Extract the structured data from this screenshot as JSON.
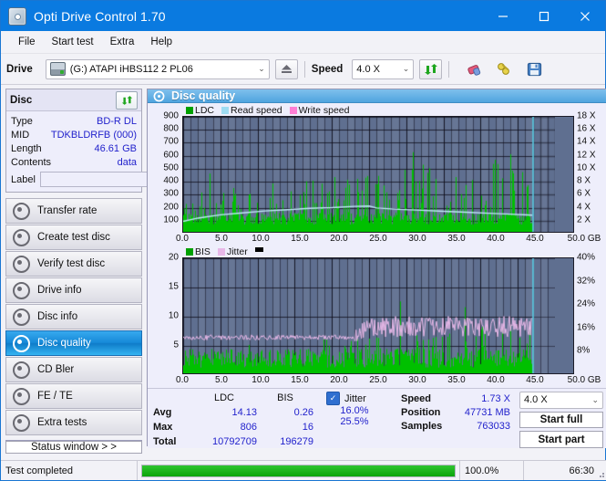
{
  "window": {
    "title": "Opti Drive Control 1.70",
    "minimize": "–",
    "maximize": "□",
    "close": "✕"
  },
  "menu": {
    "items": [
      "File",
      "Start test",
      "Extra",
      "Help"
    ]
  },
  "toolbar": {
    "drive_label": "Drive",
    "drive_value": "(G:)  ATAPI iHBS112  2 PL06",
    "eject_title": "Eject",
    "speed_label": "Speed",
    "speed_value": "4.0 X",
    "chevron": "⌄"
  },
  "disc": {
    "title": "Disc",
    "rows": [
      {
        "key": "Type",
        "value": "BD-R DL"
      },
      {
        "key": "MID",
        "value": "TDKBLDRFB (000)"
      },
      {
        "key": "Length",
        "value": "46.61 GB"
      },
      {
        "key": "Contents",
        "value": "data"
      }
    ],
    "label_key": "Label",
    "label_value": "",
    "label_placeholder": ""
  },
  "nav": {
    "items": [
      {
        "label": "Transfer rate",
        "active": false
      },
      {
        "label": "Create test disc",
        "active": false
      },
      {
        "label": "Verify test disc",
        "active": false
      },
      {
        "label": "Drive info",
        "active": false
      },
      {
        "label": "Disc info",
        "active": false
      },
      {
        "label": "Disc quality",
        "active": true
      },
      {
        "label": "CD Bler",
        "active": false
      },
      {
        "label": "FE / TE",
        "active": false
      },
      {
        "label": "Extra tests",
        "active": false
      }
    ],
    "status_window": "Status window > >"
  },
  "panel": {
    "title": "Disc quality"
  },
  "stats": {
    "col_ldc": "LDC",
    "col_bis": "BIS",
    "rows": [
      {
        "key": "Avg",
        "ldc": "14.13",
        "bis": "0.26"
      },
      {
        "key": "Max",
        "ldc": "806",
        "bis": "16"
      },
      {
        "key": "Total",
        "ldc": "10792709",
        "bis": "196279"
      }
    ],
    "jitter_label": "Jitter",
    "jitter_checked": true,
    "jitter_avg": "16.0%",
    "jitter_max": "25.5%",
    "speed_key": "Speed",
    "speed_value": "1.73 X",
    "position_key": "Position",
    "position_value": "47731 MB",
    "samples_key": "Samples",
    "samples_value": "763033",
    "speed_select": "4.0 X",
    "start_full": "Start full",
    "start_part": "Start part"
  },
  "statusbar": {
    "text": "Test completed",
    "percent": "100.0%",
    "percent_value": 100,
    "time": "66:30"
  },
  "chart_data": [
    {
      "type": "area",
      "title": "Disc quality - LDC / Read speed",
      "xlabel": "GB",
      "ylabel": "LDC",
      "y2label": "X",
      "xlim": [
        0,
        50
      ],
      "ylim": [
        0,
        900
      ],
      "y2lim": [
        0,
        18
      ],
      "grid": true,
      "legend_position": "top-left",
      "legend": [
        {
          "name": "LDC",
          "color": "#00a000"
        },
        {
          "name": "Read speed",
          "color": "#9fdcf2"
        },
        {
          "name": "Write speed",
          "color": "#ff7fd4"
        }
      ],
      "xticks": [
        "0.0",
        "5.0",
        "10.0",
        "15.0",
        "20.0",
        "25.0",
        "30.0",
        "35.0",
        "40.0",
        "45.0",
        "50.0 GB"
      ],
      "yticks": [
        900,
        800,
        700,
        600,
        500,
        400,
        300,
        200,
        100
      ],
      "y2ticks": [
        "18 X",
        "16 X",
        "14 X",
        "12 X",
        "10 X",
        "8 X",
        "6 X",
        "4 X",
        "2 X"
      ],
      "data_end_gb": 47.0,
      "series": [
        {
          "name": "LDC",
          "kind": "spikes",
          "baseline": 70,
          "noise": 90,
          "spike_chance": 0.3,
          "spike_max": 520,
          "rare_spike_max": 810,
          "color": "#00c000"
        },
        {
          "name": "Read speed",
          "kind": "line",
          "color": "#bfeaf8",
          "points": [
            [
              0.0,
              1.9
            ],
            [
              2.0,
              2.4
            ],
            [
              5.0,
              2.9
            ],
            [
              8.0,
              3.2
            ],
            [
              11.0,
              3.5
            ],
            [
              14.0,
              3.7
            ],
            [
              17.0,
              3.9
            ],
            [
              20.0,
              4.0
            ],
            [
              23.0,
              4.2
            ],
            [
              25.0,
              4.25
            ],
            [
              26.0,
              3.95
            ],
            [
              29.0,
              3.75
            ],
            [
              32.0,
              3.6
            ],
            [
              35.0,
              3.45
            ],
            [
              38.0,
              3.3
            ],
            [
              41.0,
              3.15
            ],
            [
              44.0,
              3.0
            ],
            [
              47.0,
              2.85
            ]
          ]
        }
      ]
    },
    {
      "type": "area",
      "title": "Disc quality - BIS / Jitter",
      "xlabel": "GB",
      "ylabel": "BIS",
      "y2label": "%",
      "xlim": [
        0,
        50
      ],
      "ylim": [
        0,
        20
      ],
      "y2lim": [
        0,
        40
      ],
      "grid": true,
      "legend_position": "top-left",
      "legend": [
        {
          "name": "BIS",
          "color": "#00a000"
        },
        {
          "name": "Jitter",
          "color": "#e8b8e8"
        }
      ],
      "xticks": [
        "0.0",
        "5.0",
        "10.0",
        "15.0",
        "20.0",
        "25.0",
        "30.0",
        "35.0",
        "40.0",
        "45.0",
        "50.0 GB"
      ],
      "yticks": [
        20,
        15,
        10,
        5
      ],
      "y2ticks": [
        "40%",
        "32%",
        "24%",
        "16%",
        "8%"
      ],
      "data_end_gb": 47.0,
      "series": [
        {
          "name": "BIS",
          "kind": "spikes",
          "baseline": 1.3,
          "noise": 3.2,
          "spike_chance": 0.22,
          "spike_max": 7.0,
          "rare_spike_max": 12.0,
          "color": "#00c000"
        },
        {
          "name": "Jitter",
          "kind": "band",
          "color": "#e8b8e8",
          "segments": [
            {
              "x0": 0.0,
              "x1": 23.0,
              "mean": 12.9,
              "spread": 0.9
            },
            {
              "x0": 23.0,
              "x1": 25.0,
              "mean": 15.0,
              "spread": 4.0
            },
            {
              "x0": 25.0,
              "x1": 47.0,
              "mean": 16.6,
              "spread": 3.6
            }
          ]
        }
      ]
    }
  ]
}
